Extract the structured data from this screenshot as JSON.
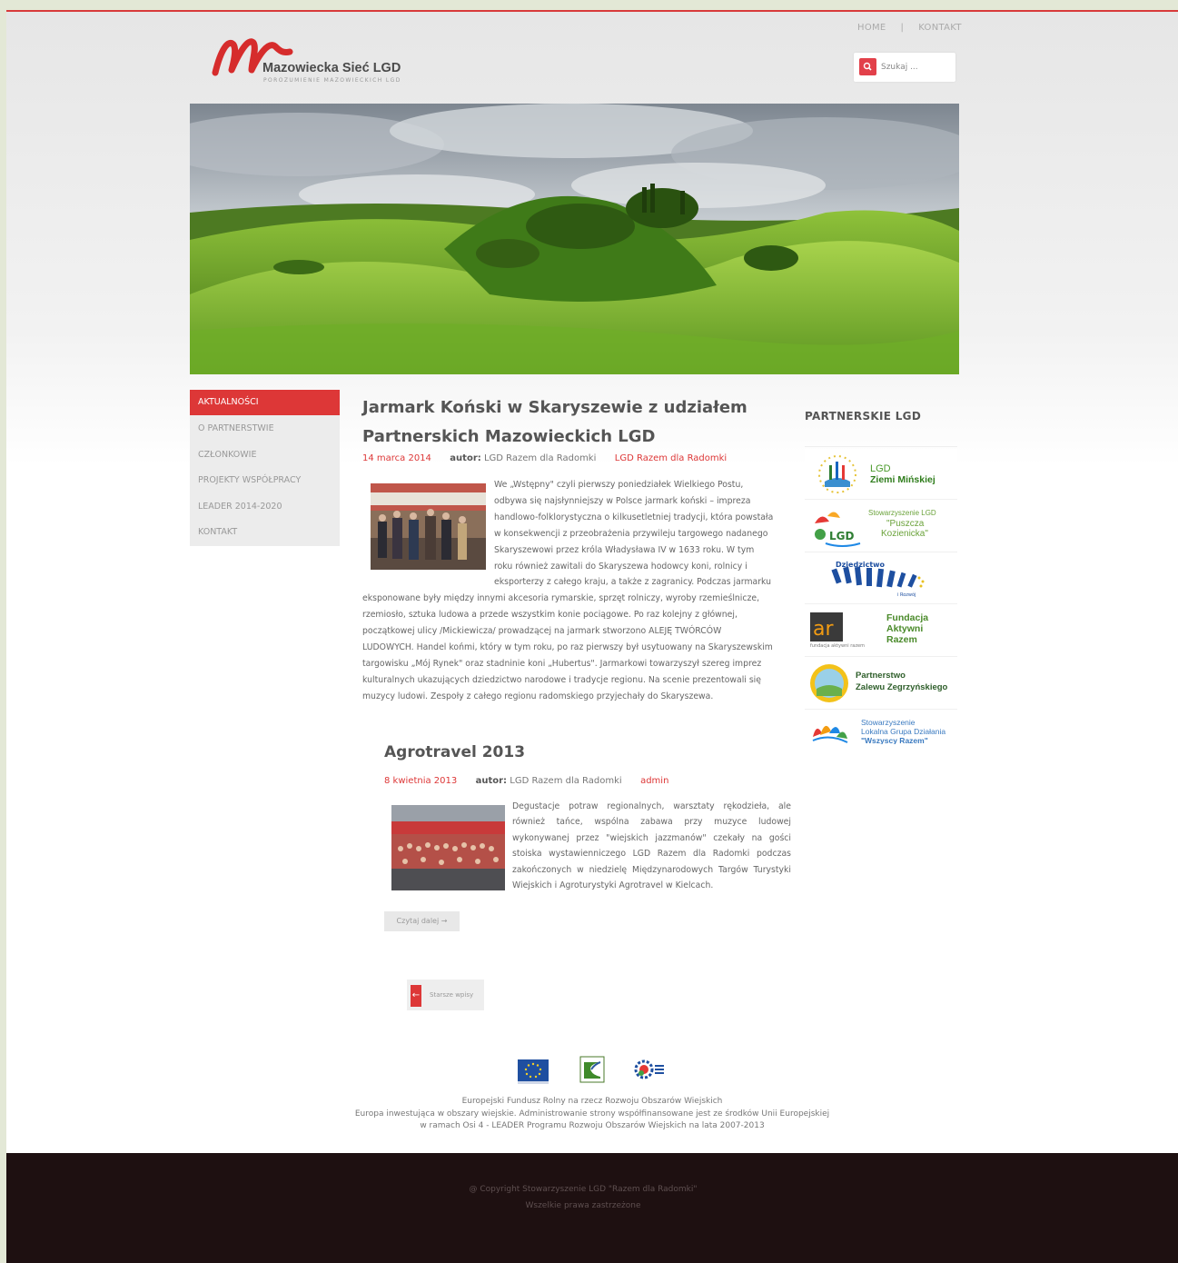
{
  "header": {
    "nav": [
      "HOME",
      "|",
      "KONTAKT"
    ],
    "logo_title": "Mazowiecka Sieć LGD",
    "logo_subtitle": "POROZUMIENIE MAZOWIECKICH LGD",
    "search_placeholder": "Szukaj ..."
  },
  "menu": {
    "items": [
      "AKTUALNOŚCI",
      "O PARTNERSTWIE",
      "CZŁONKOWIE",
      "PROJEKTY WSPÓŁPRACY",
      "LEADER 2014-2020",
      "KONTAKT"
    ],
    "active_index": 0
  },
  "articles": [
    {
      "title": "Jarmark Koński w Skaryszewie z udziałem Partnerskich Mazowieckich LGD",
      "date": "14 marca 2014",
      "author_label": "autor:",
      "author": "LGD Razem dla Radomki",
      "category": "LGD Razem dla Radomki",
      "body": "We „Wstępny\" czyli pierwszy poniedziałek Wielkiego Postu, odbywa się najsłynniejszy w Polsce jarmark koński – impreza handlowo-folklorystyczna o kilkusetletniej tradycji, która powstała w konsekwencji z przeobrażenia przywileju targowego nadanego Skaryszewowi przez króla Władysława IV w 1633 roku. W tym roku również zawitali do Skaryszewa hodowcy koni, rolnicy i eksporterzy z całego kraju, a także z zagranicy. Podczas jarmarku eksponowane były między innymi akcesoria rymarskie, sprzęt rolniczy, wyroby rzemieślnicze, rzemiosło, sztuka ludowa a przede wszystkim konie pociągowe. Po raz kolejny z głównej, początkowej ulicy /Mickiewicza/ prowadzącej na jarmark stworzono ALEJĘ TWÓRCÓW LUDOWYCH. Handel końmi, który w tym roku, po raz pierwszy był usytuowany na Skaryszewskim targowisku „Mój Rynek\" oraz stadninie koni „Hubertus\". Jarmarkowi towarzyszył szereg imprez kulturalnych ukazujących dziedzictwo narodowe i tradycje regionu. Na scenie prezentowali się muzycy ludowi. Zespoły z całego regionu radomskiego przyjechały do Skaryszewa."
    },
    {
      "title": "Agrotravel 2013",
      "date": "8 kwietnia 2013",
      "author_label": "autor:",
      "author": "LGD Razem dla Radomki",
      "category": "admin",
      "body": "Degustacje potraw regionalnych, warsztaty rękodzieła, ale również tańce, wspólna zabawa przy muzyce ludowej wykonywanej przez \"wiejskich jazzmanów\" czekały na gości stoiska wystawienniczego LGD Razem dla Radomki podczas zakończonych w niedzielę Międzynarodowych Targów Turystyki Wiejskich i Agroturystyki Agrotravel w Kielcach.",
      "read_more": "Czytaj dalej →"
    }
  ],
  "pagination": {
    "older_label": "Starsze wpisy",
    "arrow": "←"
  },
  "sidebar_right": {
    "title": "PARTNERSKIE LGD",
    "partners": [
      {
        "line1": "LGD",
        "line2": "Ziemi Mińskiej"
      },
      {
        "line1": "Stowarzyszenie LGD",
        "line2": "\"Puszcza",
        "line3": "Kozienicka\""
      },
      {
        "line1": "Dziedzictwo",
        "line2": "i Rozwój"
      },
      {
        "line1": "Fundacja",
        "line2": "Aktywni",
        "line3": "Razem",
        "small": "fundacja aktywni razem"
      },
      {
        "line1": "Partnerstwo",
        "line2": "Zalewu Zegrzyńskiego"
      },
      {
        "line1": "Stowarzyszenie",
        "line2": "Lokalna Grupa Działania",
        "line3": "\"Wszyscy Razem\""
      }
    ]
  },
  "footer": {
    "line1": "Europejski Fundusz Rolny na rzecz Rozwoju Obszarów Wiejskich",
    "line2": "Europa inwestująca w obszary wiejskie. Administrowanie strony współfinansowane jest ze środków Unii Europejskiej",
    "line3": "w ramach Osi 4 - LEADER Programu Rozwoju Obszarów Wiejskich na lata 2007-2013",
    "copyright": "@ Copyright Stowarzyszenie LGD \"Razem dla Radomki\"",
    "rights": "Wszelkie prawa zastrzeżone"
  },
  "colors": {
    "accent_red": "#dd3737",
    "footer_dark": "#1e1011",
    "page_bg": "#e3e8d6"
  }
}
